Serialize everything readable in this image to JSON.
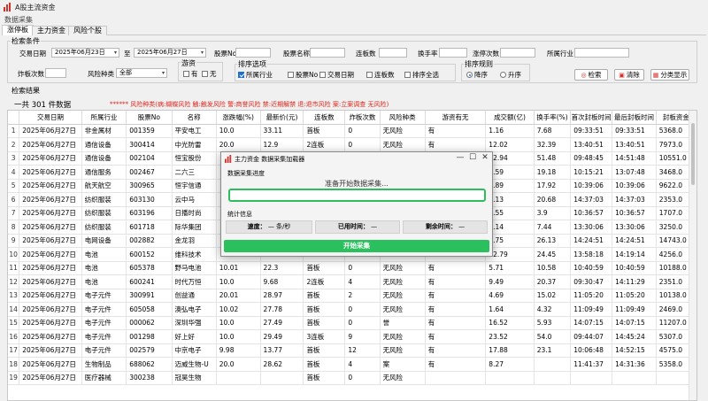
{
  "window": {
    "title": "A股主流资金",
    "menu": "数据采集",
    "controls": {
      "minimize": "—",
      "maximize": "☐",
      "close": "✕"
    }
  },
  "tabs": [
    {
      "label": "涨停板",
      "active": true
    },
    {
      "label": "主力资金",
      "active": false
    },
    {
      "label": "风险个股",
      "active": false
    }
  ],
  "filters": {
    "group_title": "检索条件",
    "trade_date_label": "交易日期",
    "date_from": "2025年06月23日",
    "to_label": "至",
    "date_to": "2025年06月27日",
    "stock_no_label": "股票No",
    "stock_no": "",
    "stock_name_label": "股票名称",
    "stock_name": "",
    "board_count_label": "连板数",
    "board_count": "",
    "turnover_label": "换手率",
    "turnover": "",
    "limit_times_label": "涨停次数",
    "limit_times": "",
    "industry_label": "所属行业",
    "industry": "",
    "burst_count_label": "炸板次数",
    "burst_count": "",
    "risk_type_label": "风险种类",
    "risk_type": "全部",
    "hot_money": {
      "title": "游资",
      "options": [
        {
          "label": "有",
          "checked": false
        },
        {
          "label": "无",
          "checked": false
        }
      ]
    },
    "sort_options": {
      "title": "排序选项",
      "items": [
        {
          "label": "所属行业",
          "checked": true
        },
        {
          "label": "股票No",
          "checked": false
        },
        {
          "label": "交易日期",
          "checked": false
        },
        {
          "label": "连板数",
          "checked": false
        },
        {
          "label": "排序全选",
          "checked": false
        }
      ]
    },
    "sort_rule": {
      "title": "排序规则",
      "items": [
        {
          "label": "降序",
          "selected": true
        },
        {
          "label": "升序",
          "selected": false
        }
      ]
    },
    "buttons": {
      "search": "检索",
      "clear": "清除",
      "category": "分类显示"
    }
  },
  "results": {
    "group_title": "检索结果",
    "summary": "一共  301  件数据",
    "risk_legend": "******   风险种类(病:蝴蝶风险 触:触发风险 警:商誉风险 禁:近期解禁 退:退市风险 案:立案调查   无风险)",
    "columns": [
      "",
      "交易日期",
      "所属行业",
      "股票No",
      "名称",
      "涨跌幅(%)",
      "最新价(元)",
      "连板数",
      "炸板次数",
      "风险种类",
      "游资有无",
      "成交额(亿)",
      "换手率(%)",
      "首次封板时间",
      "最后封板时间",
      "封板资金"
    ],
    "rows": [
      [
        "1",
        "2025年06月27日",
        "非金属材",
        "001359",
        "平安电工",
        "10.0",
        "33.11",
        "首板",
        "0",
        "无风险",
        "有",
        "1.16",
        "7.68",
        "09:33:51",
        "09:33:51",
        "5368.0"
      ],
      [
        "2",
        "2025年06月27日",
        "通信设备",
        "300414",
        "中光防雷",
        "20.0",
        "12.9",
        "2连板",
        "0",
        "无风险",
        "有",
        "12.02",
        "32.39",
        "13:40:51",
        "13:40:51",
        "7973.0"
      ],
      [
        "3",
        "2025年06月27日",
        "通信设备",
        "002104",
        "恒宝股份",
        "",
        "",
        "",
        "",
        "",
        "",
        "12.94",
        "51.48",
        "09:48:45",
        "14:51:48",
        "10551.0"
      ],
      [
        "4",
        "2025年06月27日",
        "通信服务",
        "002467",
        "二六三",
        "",
        "",
        "",
        "",
        "",
        "",
        "6.59",
        "19.18",
        "10:15:21",
        "13:07:48",
        "3468.0"
      ],
      [
        "5",
        "2025年06月27日",
        "航天航空",
        "300965",
        "恒宇信通",
        "",
        "",
        "",
        "",
        "",
        "",
        "2.89",
        "17.92",
        "10:39:06",
        "10:39:06",
        "9622.0"
      ],
      [
        "6",
        "2025年06月27日",
        "纺织服装",
        "603130",
        "云中马",
        "",
        "",
        "",
        "",
        "",
        "",
        "1.13",
        "20.68",
        "14:37:03",
        "14:37:03",
        "2353.0"
      ],
      [
        "7",
        "2025年06月27日",
        "纺织服装",
        "603196",
        "日播时尚",
        "",
        "",
        "",
        "",
        "",
        "",
        "1.55",
        "3.9",
        "10:36:57",
        "10:36:57",
        "1707.0"
      ],
      [
        "8",
        "2025年06月27日",
        "纺织服装",
        "601718",
        "际华集团",
        "",
        "",
        "",
        "",
        "",
        "",
        "1.14",
        "7.44",
        "13:30:06",
        "13:30:06",
        "3250.0"
      ],
      [
        "9",
        "2025年06月27日",
        "电网设备",
        "002882",
        "金龙羽",
        "",
        "",
        "",
        "",
        "",
        "",
        "2.75",
        "26.13",
        "14:24:51",
        "14:24:51",
        "14743.0"
      ],
      [
        "10",
        "2025年06月27日",
        "电池",
        "600152",
        "维科技术",
        "",
        "",
        "",
        "",
        "",
        "",
        "12.79",
        "24.45",
        "13:58:18",
        "14:19:14",
        "4256.0"
      ],
      [
        "11",
        "2025年06月27日",
        "电池",
        "605378",
        "野马电池",
        "10.01",
        "22.3",
        "首板",
        "0",
        "无风险",
        "有",
        "5.71",
        "10.58",
        "10:40:59",
        "10:40:59",
        "10188.0"
      ],
      [
        "12",
        "2025年06月27日",
        "电池",
        "600241",
        "时代万恒",
        "10.0",
        "9.68",
        "2连板",
        "4",
        "无风险",
        "有",
        "9.49",
        "20.37",
        "09:30:47",
        "14:11:29",
        "2351.0"
      ],
      [
        "13",
        "2025年06月27日",
        "电子元件",
        "300991",
        "创益通",
        "20.01",
        "28.97",
        "首板",
        "2",
        "无风险",
        "有",
        "4.69",
        "15.02",
        "11:05:20",
        "11:05:20",
        "10138.0"
      ],
      [
        "14",
        "2025年06月27日",
        "电子元件",
        "605058",
        "澳弘电子",
        "10.02",
        "27.78",
        "首板",
        "0",
        "无风险",
        "有",
        "1.64",
        "4.32",
        "11:09:49",
        "11:09:49",
        "2469.0"
      ],
      [
        "15",
        "2025年06月27日",
        "电子元件",
        "000062",
        "深圳华强",
        "10.0",
        "27.49",
        "首板",
        "0",
        "誉",
        "有",
        "16.52",
        "5.93",
        "14:07:15",
        "14:07:15",
        "11207.0"
      ],
      [
        "16",
        "2025年06月27日",
        "电子元件",
        "001298",
        "好上好",
        "10.0",
        "29.49",
        "3连板",
        "9",
        "无风险",
        "有",
        "23.52",
        "54.0",
        "09:44:07",
        "14:45:24",
        "5307.0"
      ],
      [
        "17",
        "2025年06月27日",
        "电子元件",
        "002579",
        "中京电子",
        "9.98",
        "13.77",
        "首板",
        "12",
        "无风险",
        "有",
        "17.88",
        "23.1",
        "10:06:48",
        "14:52:15",
        "4575.0"
      ],
      [
        "18",
        "2025年06月27日",
        "生物制品",
        "688062",
        "迈威生物-U",
        "20.0",
        "28.62",
        "首板",
        "4",
        "案",
        "有",
        "8.27",
        "",
        "11:41:37",
        "14:31:36",
        "5358.0"
      ],
      [
        "19",
        "2025年06月27日",
        "医疗器械",
        "300238",
        "冠昊生物",
        "",
        "",
        "首板",
        "0",
        "无风险",
        "",
        "",
        "",
        "",
        "",
        ""
      ]
    ]
  },
  "dialog": {
    "title": "主力资金 数据采集加载器",
    "progress_section": "数据采集进度",
    "status": "准备开始数据采集...",
    "progress_value": 0,
    "stats_section": "统计信息",
    "speed_label": "速度：",
    "speed_value": "— 条/秒",
    "elapsed_label": "已用时间：",
    "elapsed_value": "—",
    "remaining_label": "剩余时间：",
    "remaining_value": "—",
    "start_button": "开始采集",
    "controls": {
      "minimize": "—",
      "maximize": "☐",
      "close": "✕"
    }
  }
}
